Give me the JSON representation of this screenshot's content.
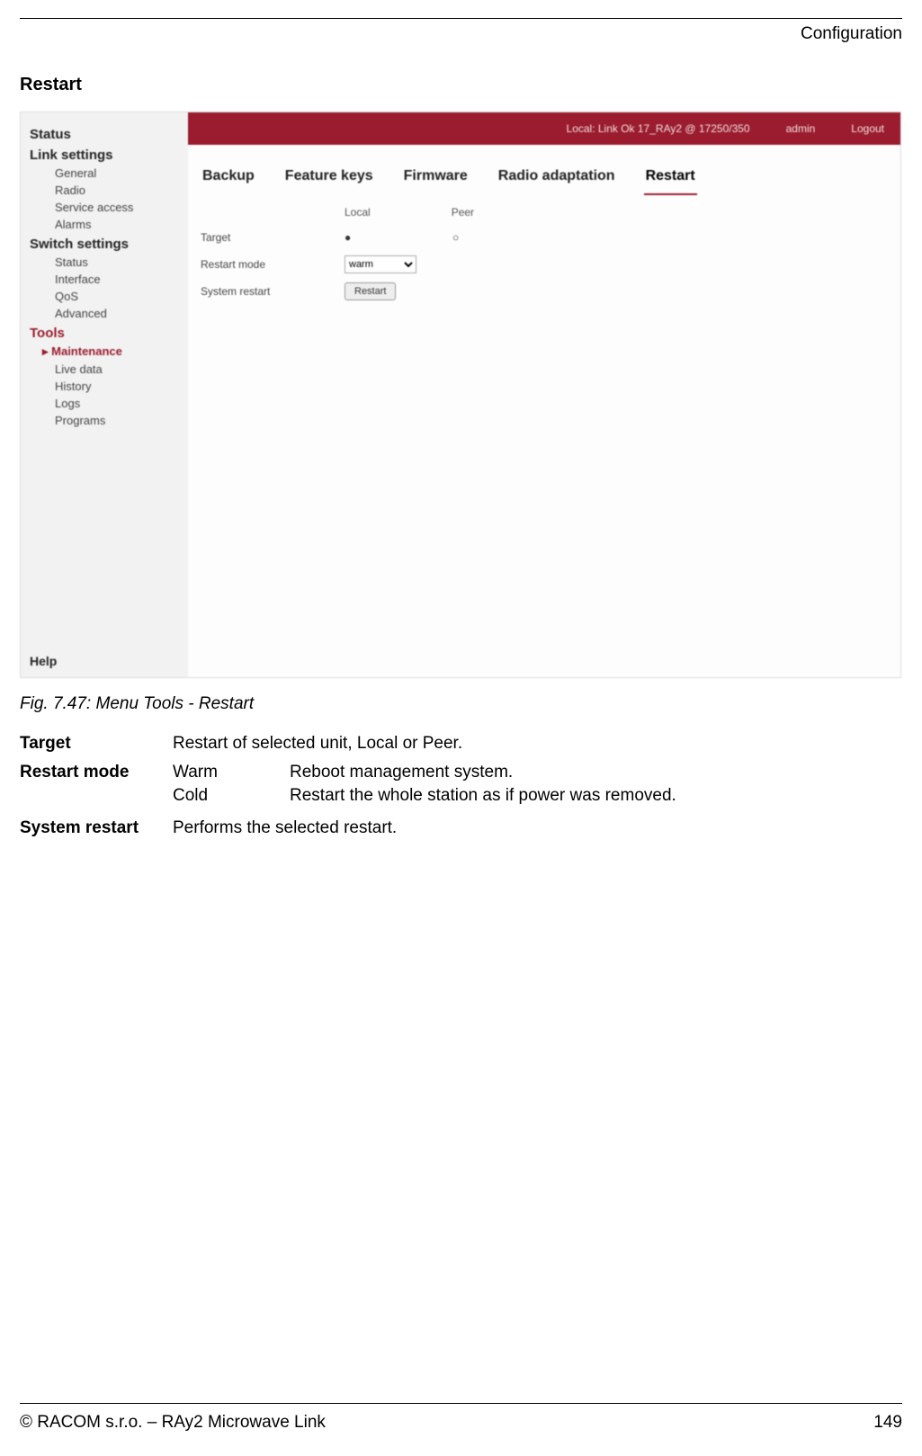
{
  "header": {
    "title": "Configuration"
  },
  "section": {
    "heading": "Restart"
  },
  "screenshot": {
    "sidebar": {
      "items": [
        {
          "label": "Status",
          "type": "grp"
        },
        {
          "label": "Link settings",
          "type": "grp"
        },
        {
          "label": "General",
          "type": "sub"
        },
        {
          "label": "Radio",
          "type": "sub"
        },
        {
          "label": "Service access",
          "type": "sub"
        },
        {
          "label": "Alarms",
          "type": "sub"
        },
        {
          "label": "Switch settings",
          "type": "grp"
        },
        {
          "label": "Status",
          "type": "sub"
        },
        {
          "label": "Interface",
          "type": "sub"
        },
        {
          "label": "QoS",
          "type": "sub"
        },
        {
          "label": "Advanced",
          "type": "sub"
        },
        {
          "label": "Tools",
          "type": "grp tools"
        },
        {
          "label": "Maintenance",
          "type": "sub active"
        },
        {
          "label": "Live data",
          "type": "sub"
        },
        {
          "label": "History",
          "type": "sub"
        },
        {
          "label": "Logs",
          "type": "sub"
        },
        {
          "label": "Programs",
          "type": "sub"
        }
      ],
      "help": "Help"
    },
    "topbar": {
      "left": "Local: Link Ok 17_RAy2 @ 17250/350",
      "middle": "admin",
      "right": "Logout"
    },
    "tabs": [
      "Backup",
      "Feature keys",
      "Firmware",
      "Radio adaptation",
      "Restart"
    ],
    "active_tab_index": 4,
    "form": {
      "cols": [
        "Local",
        "Peer"
      ],
      "rows": [
        {
          "label": "Target",
          "local": "●",
          "peer": "○"
        },
        {
          "label": "Restart mode",
          "local_select": "warm"
        },
        {
          "label": "System restart",
          "button": "Restart"
        }
      ]
    }
  },
  "caption": "Fig. 7.47: Menu Tools - Restart",
  "definitions": [
    {
      "term": "Target",
      "desc": "Restart of selected unit, Local or Peer."
    },
    {
      "term": "Restart mode",
      "sub": [
        {
          "k": "Warm",
          "v": "Reboot management system."
        },
        {
          "k": "Cold",
          "v": "Restart the whole station as if power was removed."
        }
      ]
    },
    {
      "term": "System restart",
      "desc": "Performs the selected restart."
    }
  ],
  "footer": {
    "left": "© RACOM s.r.o. – RAy2 Microwave Link",
    "right": "149"
  }
}
